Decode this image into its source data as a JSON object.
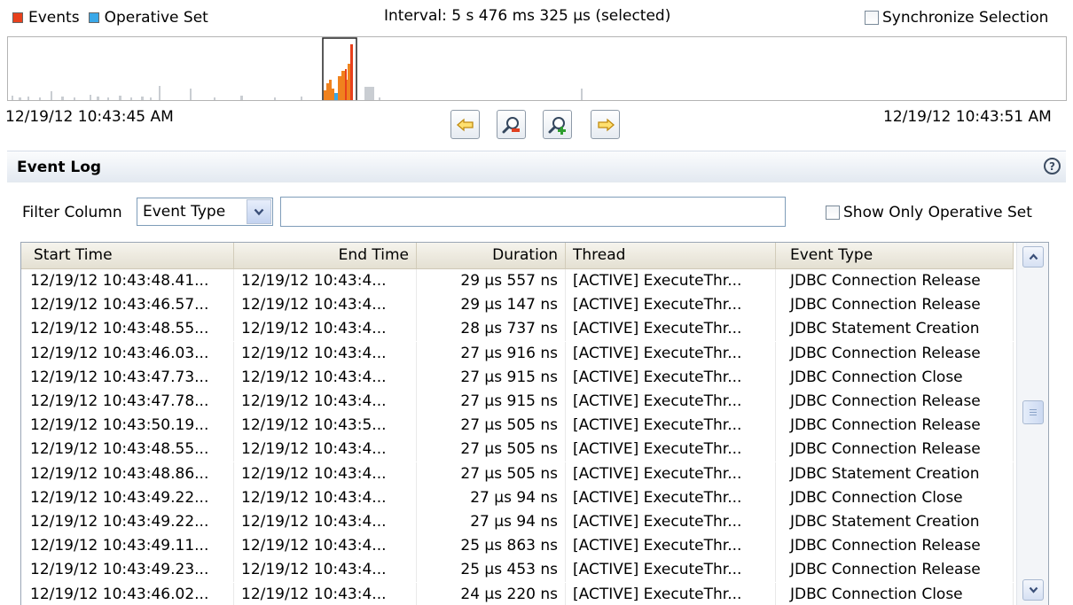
{
  "legend": {
    "events_label": "Events",
    "operative_label": "Operative Set",
    "events_color": "#e8401c",
    "operative_color": "#3aa8e8"
  },
  "interval": "Interval: 5 s 476 ms 325 µs (selected)",
  "sync_label": "Synchronize Selection",
  "timeline": {
    "start": "12/19/12 10:43:45 AM",
    "end": "12/19/12 10:43:51 AM"
  },
  "nav": {
    "back_icon": "left-arrow-icon",
    "zoom_out_icon": "zoom-out-icon",
    "zoom_in_icon": "zoom-in-icon",
    "forward_icon": "right-arrow-icon"
  },
  "event_log": {
    "title": "Event Log",
    "help": "?"
  },
  "filter": {
    "label": "Filter Column",
    "selected": "Event Type",
    "text": "",
    "operative_only_label": "Show Only Operative Set"
  },
  "table": {
    "columns": [
      "Start Time",
      "End Time",
      "Duration",
      "Thread",
      "Event Type"
    ],
    "rows": [
      [
        "12/19/12 10:43:48.41...",
        "12/19/12 10:43:4...",
        "29 µs 557 ns",
        "[ACTIVE] ExecuteThr...",
        "JDBC Connection Release"
      ],
      [
        "12/19/12 10:43:46.57...",
        "12/19/12 10:43:4...",
        "29 µs 147 ns",
        "[ACTIVE] ExecuteThr...",
        "JDBC Connection Release"
      ],
      [
        "12/19/12 10:43:48.55...",
        "12/19/12 10:43:4...",
        "28 µs 737 ns",
        "[ACTIVE] ExecuteThr...",
        "JDBC Statement Creation"
      ],
      [
        "12/19/12 10:43:46.03...",
        "12/19/12 10:43:4...",
        "27 µs 916 ns",
        "[ACTIVE] ExecuteThr...",
        "JDBC Connection Release"
      ],
      [
        "12/19/12 10:43:47.73...",
        "12/19/12 10:43:4...",
        "27 µs 915 ns",
        "[ACTIVE] ExecuteThr...",
        "JDBC Connection Close"
      ],
      [
        "12/19/12 10:43:47.78...",
        "12/19/12 10:43:4...",
        "27 µs 915 ns",
        "[ACTIVE] ExecuteThr...",
        "JDBC Connection Release"
      ],
      [
        "12/19/12 10:43:50.19...",
        "12/19/12 10:43:5...",
        "27 µs 505 ns",
        "[ACTIVE] ExecuteThr...",
        "JDBC Connection Release"
      ],
      [
        "12/19/12 10:43:48.55...",
        "12/19/12 10:43:4...",
        "27 µs 505 ns",
        "[ACTIVE] ExecuteThr...",
        "JDBC Connection Release"
      ],
      [
        "12/19/12 10:43:48.86...",
        "12/19/12 10:43:4...",
        "27 µs 505 ns",
        "[ACTIVE] ExecuteThr...",
        "JDBC Statement Creation"
      ],
      [
        "12/19/12 10:43:49.22...",
        "12/19/12 10:43:4...",
        "27 µs 94 ns",
        "[ACTIVE] ExecuteThr...",
        "JDBC Connection Close"
      ],
      [
        "12/19/12 10:43:49.22...",
        "12/19/12 10:43:4...",
        "27 µs 94 ns",
        "[ACTIVE] ExecuteThr...",
        "JDBC Statement Creation"
      ],
      [
        "12/19/12 10:43:49.11...",
        "12/19/12 10:43:4...",
        "25 µs 863 ns",
        "[ACTIVE] ExecuteThr...",
        "JDBC Connection Release"
      ],
      [
        "12/19/12 10:43:49.23...",
        "12/19/12 10:43:4...",
        "25 µs 453 ns",
        "[ACTIVE] ExecuteThr...",
        "JDBC Connection Release"
      ],
      [
        "12/19/12 10:43:46.02...",
        "12/19/12 10:43:4...",
        "24 µs 220 ns",
        "[ACTIVE] ExecuteThr...",
        "JDBC Connection Close"
      ]
    ]
  },
  "scrollbar": {
    "up_icon": "scroll-up-icon",
    "down_icon": "scroll-down-icon",
    "thumb_icon": "grip-icon"
  }
}
